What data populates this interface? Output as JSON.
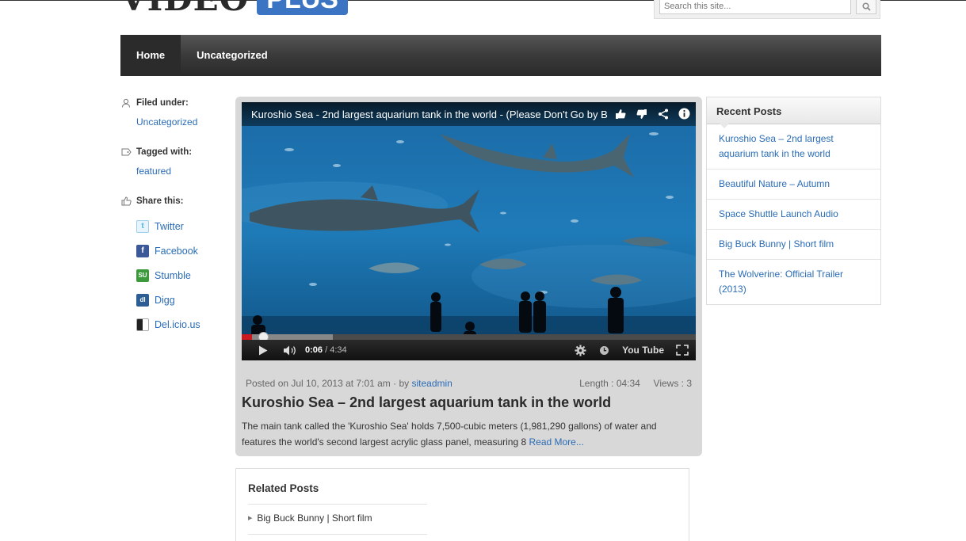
{
  "header": {
    "logo_part1": "VIDEO",
    "logo_part2": "PLUS",
    "search_placeholder": "Search this site..."
  },
  "nav": {
    "items": [
      {
        "label": "Home",
        "active": true
      },
      {
        "label": "Uncategorized",
        "active": false
      }
    ]
  },
  "meta": {
    "filed_under_label": "Filed under:",
    "filed_under_value": "Uncategorized",
    "tagged_with_label": "Tagged with:",
    "tagged_with_value": "featured",
    "share_label": "Share this:",
    "share": [
      {
        "label": "Twitter",
        "icon": "twitter-icon",
        "color": "#4fb3e6"
      },
      {
        "label": "Facebook",
        "icon": "facebook-icon",
        "color": "#3b5998"
      },
      {
        "label": "Stumble",
        "icon": "stumbleupon-icon",
        "color": "#3c9a3c"
      },
      {
        "label": "Digg",
        "icon": "digg-icon",
        "color": "#2c5e94"
      },
      {
        "label": "Del.icio.us",
        "icon": "delicious-icon",
        "color": "#222222"
      }
    ]
  },
  "video": {
    "title": "Kuroshio Sea - 2nd largest aquarium tank in the world - (Please Don't Go by B...",
    "current_time": "0:06",
    "duration": "/ 4:34",
    "progress_fraction": 0.022,
    "buffered_fraction": 0.2,
    "youtube_label": "You Tube"
  },
  "post": {
    "posted_prefix": "Posted on Jul 10, 2013 at 7:01 am · by",
    "author": "siteadmin",
    "length": "Length : 04:34",
    "views": "Views : 3",
    "title": "Kuroshio Sea – 2nd largest aquarium tank in the world",
    "excerpt": "The main tank called the 'Kuroshio Sea' holds 7,500-cubic meters (1,981,290 gallons) of water and features the world's second largest acrylic glass panel, measuring 8",
    "read_more": "Read More..."
  },
  "related": {
    "heading": "Related Posts",
    "items": [
      "Big Buck Bunny | Short film"
    ]
  },
  "recent": {
    "heading": "Recent Posts",
    "items": [
      "Kuroshio Sea – 2nd largest aquarium tank in the world",
      "Beautiful Nature – Autumn",
      "Space Shuttle Launch Audio",
      "Big Buck Bunny | Short film",
      "The Wolverine: Official Trailer (2013)"
    ]
  },
  "colors": {
    "link": "#2a6cb5",
    "nav_bg": "#3a3a3a",
    "logo_accent": "#3a74c2",
    "progress_red": "#cc181e"
  }
}
